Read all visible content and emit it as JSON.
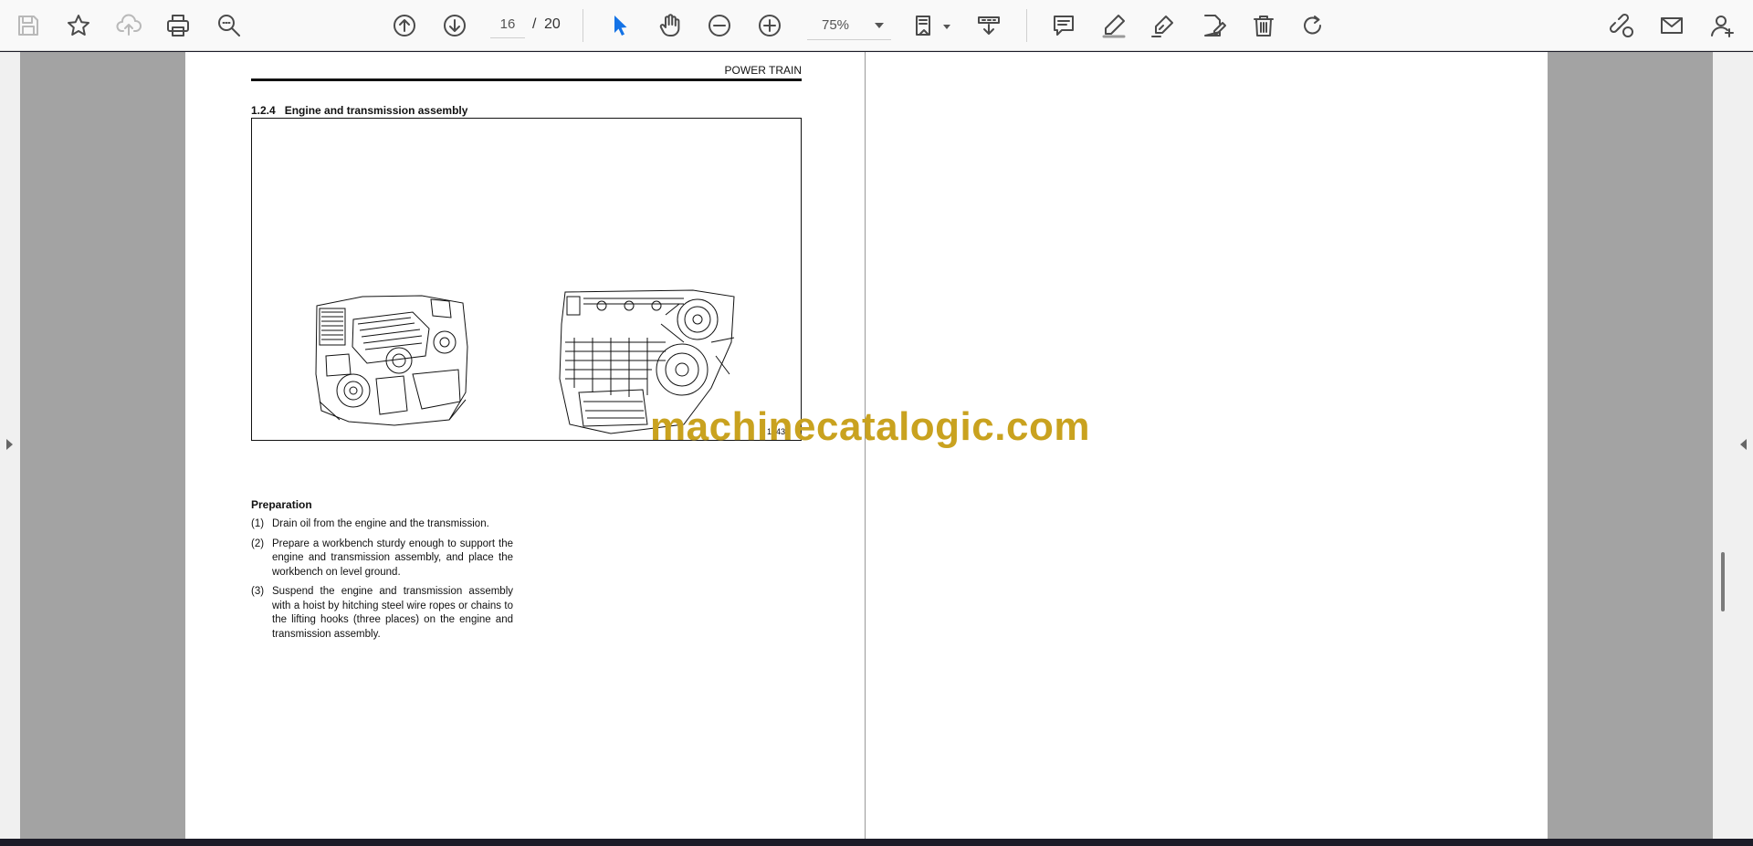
{
  "toolbar": {
    "page_current": "16",
    "page_separator": "/",
    "page_total": "20",
    "zoom": "75%",
    "tools": [
      "save-icon",
      "bookmark-star-icon",
      "upload-cloud-icon",
      "print-icon",
      "zoom-search-icon",
      "page-up-icon",
      "page-down-icon",
      "zoom-out-icon",
      "zoom-in-icon",
      "select-cursor-icon",
      "hand-pan-icon",
      "page-fit-icon",
      "scroll-mode-icon",
      "comment-icon",
      "highlight-pen-icon",
      "sign-pen-icon",
      "edit-doc-icon",
      "delete-icon",
      "rotate-icon",
      "share-link-icon",
      "email-icon",
      "add-user-icon"
    ]
  },
  "document": {
    "running_head": "POWER TRAIN",
    "section_number": "1.2.4",
    "section_title": "Engine and transmission assembly",
    "figure_code": "15434",
    "preparation_heading": "Preparation",
    "steps": [
      {
        "num": "(1)",
        "text": "Drain oil from the engine and the transmission."
      },
      {
        "num": "(2)",
        "text": "Prepare a workbench sturdy enough to support the engine and transmission assembly, and place the workbench on level ground."
      },
      {
        "num": "(3)",
        "text": "Suspend the engine and transmission assembly with a hoist by hitching steel wire ropes or chains to the lifting hooks (three places) on the engine and transmission assembly."
      }
    ]
  },
  "watermark": "machinecatalogic.com",
  "colors": {
    "toolbar_bg": "#f9f9f9",
    "viewer_bg": "#a3a3a3",
    "accent_blue": "#1473e6",
    "watermark": "#c9a21f"
  }
}
